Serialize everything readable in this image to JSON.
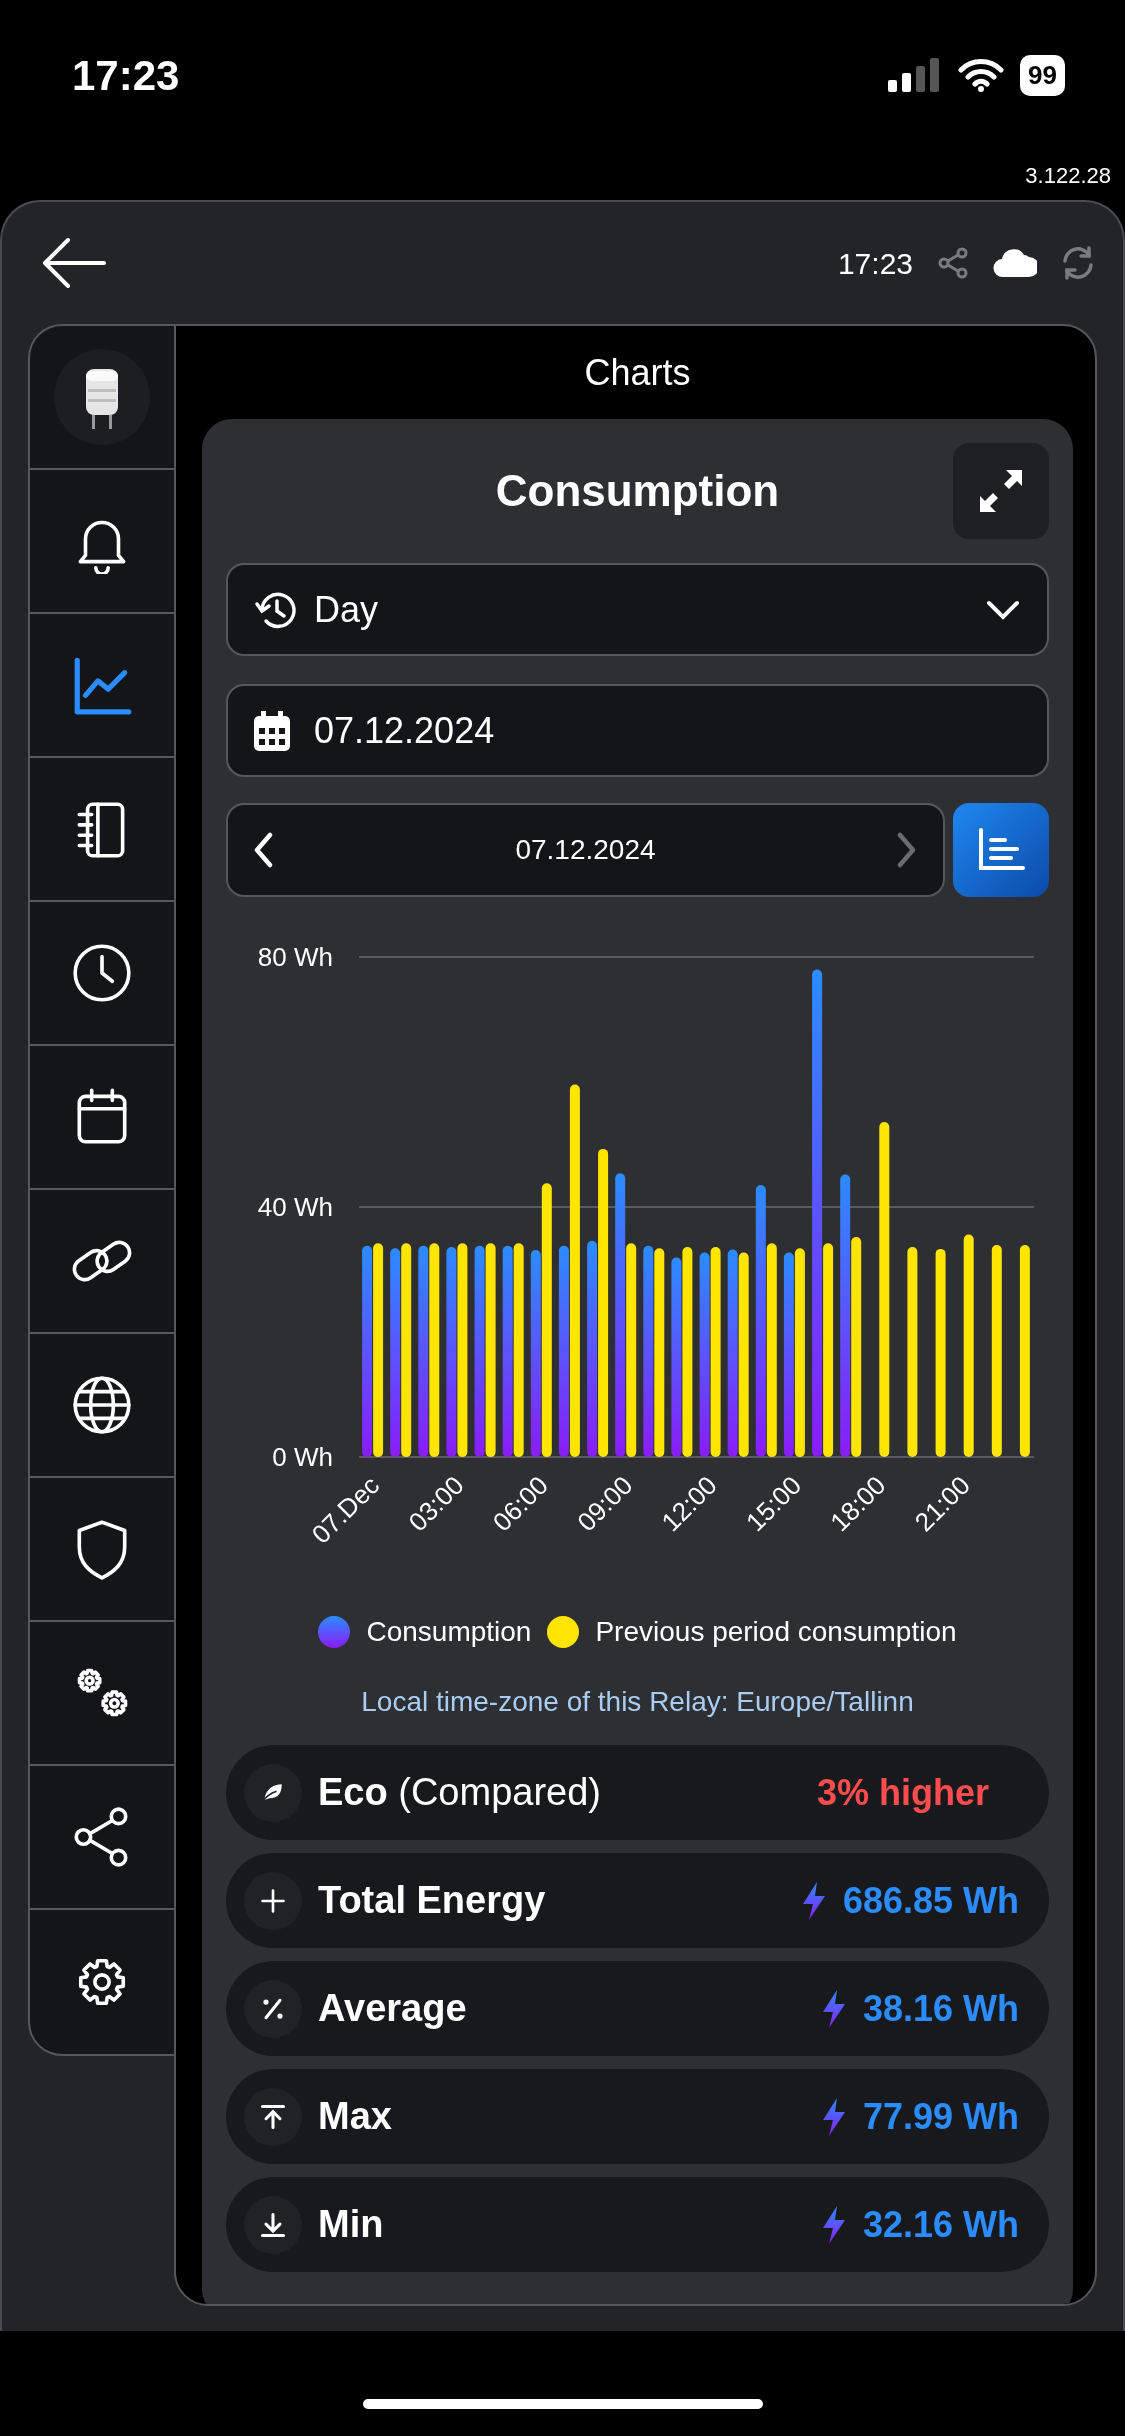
{
  "status_bar": {
    "time": "17:23",
    "battery": "99"
  },
  "version": "3.122.28",
  "header": {
    "time": "17:23"
  },
  "sidebar": {
    "items": [
      {
        "selected": false
      },
      {
        "selected": true
      },
      {
        "selected": false
      },
      {
        "selected": false
      },
      {
        "selected": false
      },
      {
        "selected": false
      },
      {
        "selected": false
      },
      {
        "selected": false
      },
      {
        "selected": false
      },
      {
        "selected": false
      },
      {
        "selected": false
      }
    ]
  },
  "page_title": "Charts",
  "card": {
    "title": "Consumption",
    "period": {
      "value": "Day"
    },
    "date_field": {
      "value": "07.12.2024"
    },
    "navigator": {
      "date": "07.12.2024",
      "prev_disabled": false,
      "next_disabled": true
    },
    "chart_data": {
      "type": "bar",
      "xlim": [
        -0.5,
        23.5
      ],
      "x": [
        0,
        1,
        2,
        3,
        4,
        5,
        6,
        7,
        8,
        9,
        10,
        11,
        12,
        13,
        14,
        15,
        16,
        17,
        18,
        19,
        20,
        21,
        22,
        23
      ],
      "ylim": [
        0,
        80
      ],
      "yticks": [
        {
          "value": 0,
          "label": "0 Wh"
        },
        {
          "value": 40,
          "label": "40 Wh"
        },
        {
          "value": 80,
          "label": "80 Wh"
        }
      ],
      "xticks": [
        {
          "value": 0,
          "label": "07.Dec"
        },
        {
          "value": 3,
          "label": "03:00"
        },
        {
          "value": 6,
          "label": "06:00"
        },
        {
          "value": 9,
          "label": "09:00"
        },
        {
          "value": 12,
          "label": "12:00"
        },
        {
          "value": 15,
          "label": "15:00"
        },
        {
          "value": 18,
          "label": "18:00"
        },
        {
          "value": 21,
          "label": "21:00"
        }
      ],
      "series": [
        {
          "name": "Consumption",
          "color": "#2b8cff",
          "values": [
            33.8,
            33.4,
            33.8,
            33.6,
            33.8,
            33.8,
            33.1,
            33.8,
            34.6,
            45.4,
            33.8,
            31.9,
            32.7,
            33.2,
            43.5,
            32.7,
            78,
            45.2,
            null,
            null,
            null,
            null,
            null,
            null
          ]
        },
        {
          "name": "Previous period consumption",
          "color": "#ffe500",
          "values": [
            34.2,
            34.2,
            34.2,
            34.2,
            34.2,
            34.2,
            43.8,
            59.6,
            49.3,
            34.2,
            33.4,
            33.6,
            33.6,
            32.7,
            34.2,
            33.4,
            34.2,
            35.2,
            53.6,
            33.6,
            33.3,
            35.6,
            33.9,
            33.9
          ]
        }
      ]
    },
    "timezone_note": "Local time-zone of this Relay: Europe/Tallinn",
    "stats": [
      {
        "kind": "comparison",
        "label": "Eco",
        "note": "(Compared)",
        "value": "3% higher"
      },
      {
        "kind": "energy",
        "label": "Total Energy",
        "value": "686.85 Wh"
      },
      {
        "kind": "energy",
        "label": "Average",
        "value": "38.16 Wh"
      },
      {
        "kind": "energy",
        "label": "Max",
        "value": "77.99 Wh"
      },
      {
        "kind": "energy",
        "label": "Min",
        "value": "32.16 Wh"
      }
    ]
  }
}
